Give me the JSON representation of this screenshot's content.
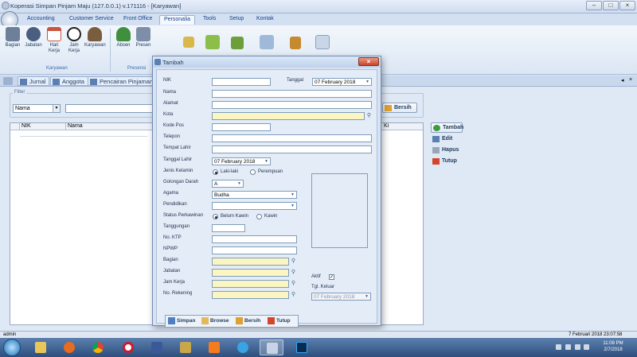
{
  "window": {
    "title": "Koperasi Simpan Pinjam Maju (127.0.0.1) v.171116 - [Karyawan]"
  },
  "ribbon_tabs": [
    "Accounting",
    "Customer Service",
    "Front Office",
    "Personalia",
    "Tools",
    "Setup",
    "Kontak"
  ],
  "ribbon": {
    "buttons": [
      {
        "label": "Bagian",
        "icon": "bagian-icon",
        "color": "#6d7f99"
      },
      {
        "label": "Jabatan",
        "icon": "jabatan-icon",
        "color": "#4a5e80"
      },
      {
        "label": "Hari Kerja",
        "icon": "calendar-icon",
        "color": "#c8553d"
      },
      {
        "label": "Jam Kerja",
        "icon": "clock-icon",
        "color": "#e8e8e8"
      },
      {
        "label": "Karyawan",
        "icon": "employees-icon",
        "color": "#7a5c3e"
      },
      {
        "label": "Absen",
        "icon": "absen-icon",
        "color": "#3f8f3f"
      },
      {
        "label": "Presen",
        "icon": "presensi-icon",
        "color": "#7f8ea8"
      }
    ],
    "groups": [
      "Karyawan",
      "Presensi"
    ]
  },
  "doc_tabs": [
    "Jurnal",
    "Anggota",
    "Pencairan Pinjaman"
  ],
  "filter": {
    "label": "Filter",
    "field": "Nama",
    "reset_button": "Bersih"
  },
  "grid": {
    "columns": [
      "NIK",
      "Nama",
      "Ki"
    ]
  },
  "side_buttons": [
    "Tambah",
    "Edit",
    "Hapus",
    "Tutup"
  ],
  "dialog": {
    "title": "Tambah",
    "labels": {
      "nik": "NIK",
      "tanggal": "Tanggal",
      "nama": "Nama",
      "alamat": "Alamat",
      "kota": "Kota",
      "kode_pos": "Kode Pos",
      "telepon": "Telepon",
      "tempat_lahir": "Tempat Lahir",
      "tanggal_lahir": "Tanggal Lahir",
      "jenis_kelamin": "Jenis Kelamin",
      "golongan_darah": "Golongan Darah",
      "agama": "Agama",
      "pendidikan": "Pendidikan",
      "status_perkawinan": "Status Perkawinan",
      "tanggungan": "Tanggungan",
      "no_ktp": "No. KTP",
      "npwp": "NPWP",
      "bagian": "Bagian",
      "jabatan": "Jabatan",
      "jam_kerja": "Jam Kerja",
      "no_rekening": "No. Rekening",
      "aktif": "Aktif",
      "tgl_keluar": "Tgl. Keluar"
    },
    "values": {
      "tanggal": "07  February  2018",
      "tanggal_lahir": "07  February  2018",
      "golongan_darah": "A",
      "agama": "Budha",
      "tgl_keluar": "07  February  2018",
      "aktif_checked": true
    },
    "options": {
      "gender_male": "Laki-laki",
      "gender_female": "Perempuan",
      "status_single": "Belum Kawin",
      "status_married": "Kawin"
    },
    "buttons": [
      "Simpan",
      "Browse",
      "Bersih",
      "Tutup"
    ]
  },
  "statusbar": {
    "user": "admin",
    "datetime": "7 Februari 2018  23:07:58"
  },
  "taskbar": {
    "time": "11:08 PM",
    "date": "2/7/2018"
  }
}
